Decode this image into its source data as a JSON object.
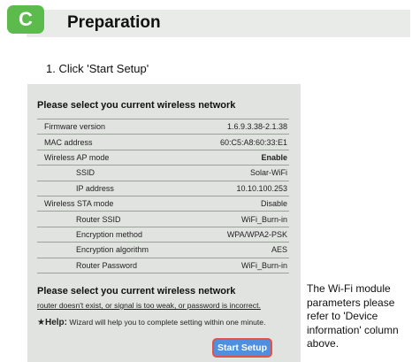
{
  "header": {
    "badge": "C",
    "title": "Preparation"
  },
  "step": "1. Click 'Start Setup'",
  "panel": {
    "title": "Please select you current wireless network",
    "rows": [
      {
        "label": "Firmware version",
        "value": "1.6.9.3.38-2.1.38"
      },
      {
        "label": "MAC address",
        "value": "60:C5:A8:60:33:E1"
      },
      {
        "label": "Wireless AP mode",
        "value": "Enable"
      },
      {
        "label": "SSID",
        "value": "Solar-WiFi"
      },
      {
        "label": "IP address",
        "value": "10.10.100.253"
      },
      {
        "label": "Wireless STA mode",
        "value": "Disable"
      },
      {
        "label": "Router SSID",
        "value": "WiFi_Burn-in"
      },
      {
        "label": "Encryption method",
        "value": "WPA/WPA2-PSK"
      },
      {
        "label": "Encryption algorithm",
        "value": "AES"
      },
      {
        "label": "Router Password",
        "value": "WiFi_Burn-in"
      }
    ],
    "title2": "Please select you current wireless network",
    "note": "router doesn't exist, or signal is too weak, or password is incorrect.",
    "help_star": "★",
    "help_label": "Help:",
    "help_text": " Wizard will help you to complete setting within one minute.",
    "button": "Start Setup"
  },
  "side_note": "The Wi-Fi module parameters please refer to 'Device information' column above."
}
